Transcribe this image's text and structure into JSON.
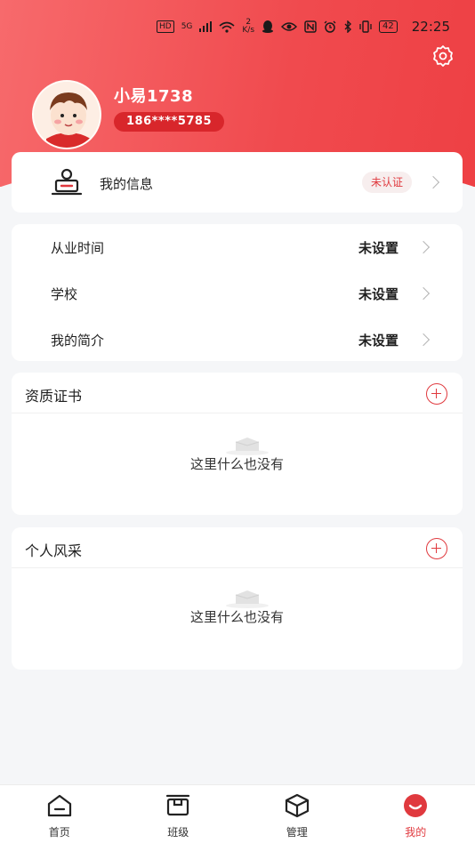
{
  "status_bar": {
    "time": "22:25",
    "battery": "42",
    "net_speed_value": "2",
    "net_speed_unit": "K/s",
    "hd": "HD",
    "signal": "5G"
  },
  "profile": {
    "username": "小易1738",
    "phone": "186****5785"
  },
  "my_info": {
    "label": "我的信息",
    "badge": "未认证"
  },
  "details": [
    {
      "label": "从业时间",
      "value": "未设置"
    },
    {
      "label": "学校",
      "value": "未设置"
    },
    {
      "label": "我的简介",
      "value": "未设置"
    }
  ],
  "sections": {
    "certificates": {
      "title": "资质证书",
      "empty_text": "这里什么也没有"
    },
    "personal_style": {
      "title": "个人风采",
      "empty_text": "这里什么也没有"
    }
  },
  "tabs": [
    {
      "label": "首页",
      "icon": "home-icon",
      "active": false
    },
    {
      "label": "班级",
      "icon": "class-icon",
      "active": false
    },
    {
      "label": "管理",
      "icon": "box-icon",
      "active": false
    },
    {
      "label": "我的",
      "icon": "profile-icon",
      "active": true
    }
  ],
  "colors": {
    "brand": "#f04a4e",
    "accent_red": "#e0393e"
  }
}
